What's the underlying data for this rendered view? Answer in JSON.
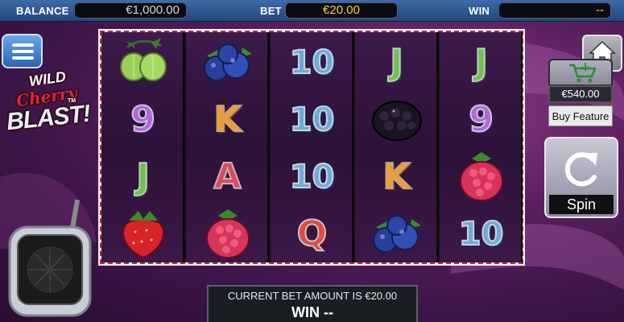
{
  "topbar": {
    "balance_label": "BALANCE",
    "balance_value": "€1,000.00",
    "bet_label": "BET",
    "bet_value": "€20.00",
    "win_label": "WIN",
    "win_value": "--"
  },
  "logo": {
    "wild": "WILD",
    "cherry": "Cherry",
    "blast": "BLAST!",
    "tm": "TM"
  },
  "reels": [
    [
      "gooseberry",
      "9",
      "J",
      "strawberry"
    ],
    [
      "blueberry",
      "K",
      "A",
      "raspberry"
    ],
    [
      "10",
      "10",
      "10",
      "Q"
    ],
    [
      "J",
      "blackberry",
      "K",
      "blueberry"
    ],
    [
      "J",
      "9",
      "raspberry",
      "10"
    ]
  ],
  "buy_feature": {
    "price": "€540.00",
    "label": "Buy Feature",
    "icon": "cart-icon"
  },
  "spin": {
    "label": "Spin",
    "icon": "spin-arrow-icon"
  },
  "home": {
    "icon": "home-icon"
  },
  "menu": {
    "icon": "hamburger-icon"
  },
  "bottom": {
    "line1": "CURRENT BET AMOUNT IS €20.00",
    "line2": "WIN --"
  },
  "colors": {
    "accent_yellow": "#ffd21c",
    "topbar_blue": "#2f5a95",
    "bg_purple": "#4a1a52"
  }
}
